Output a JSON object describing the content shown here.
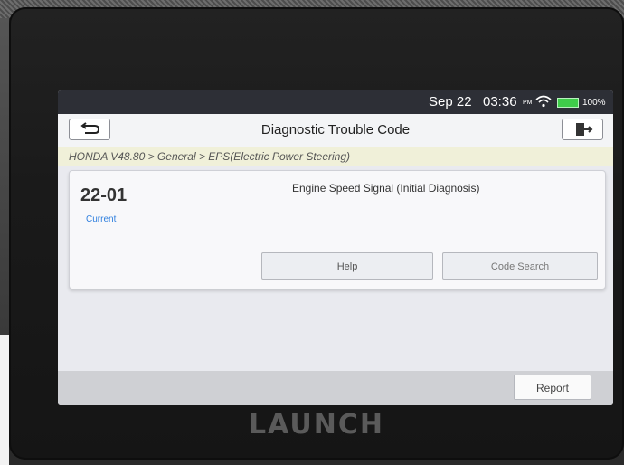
{
  "status_bar": {
    "date": "Sep 22",
    "time": "03:36",
    "ampm": "PM",
    "battery": "100%",
    "wifi_icon": "wifi-icon",
    "battery_icon": "battery-icon"
  },
  "header": {
    "title": "Diagnostic Trouble Code",
    "back_icon": "back-arrow-icon",
    "exit_icon": "exit-icon"
  },
  "breadcrumb": "HONDA V48.80 > General > EPS(Electric Power Steering)",
  "dtc": {
    "code": "22-01",
    "status": "Current",
    "description": "Engine Speed Signal (Initial Diagnosis)",
    "help_label": "Help",
    "code_search_label": "Code Search"
  },
  "footer": {
    "report_label": "Report"
  },
  "device_brand": "LAUNCH",
  "colors": {
    "status_current": "#2f7fde",
    "battery_fill": "#3fcc4a",
    "breadcrumb_bg": "#f0f0d9"
  }
}
